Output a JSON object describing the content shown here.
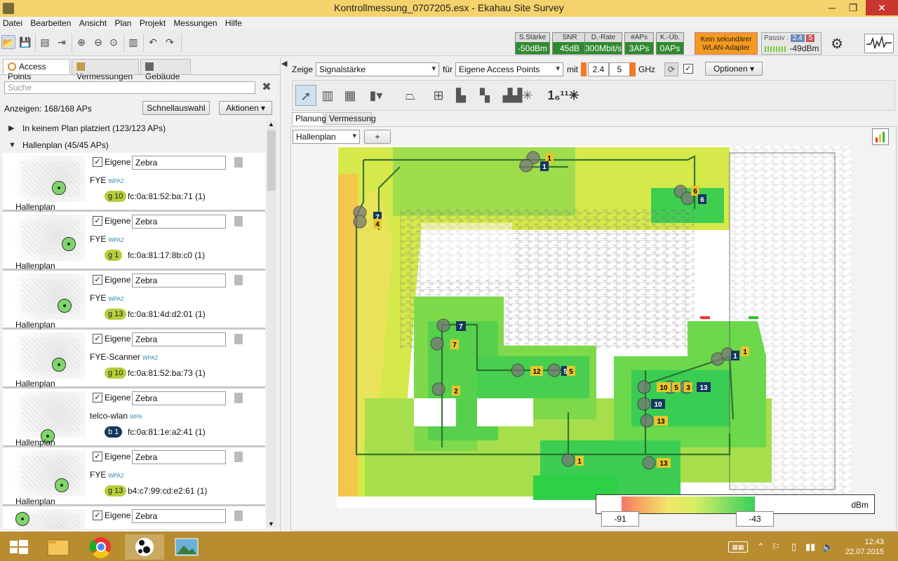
{
  "window": {
    "title": "Kontrollmessung_0707205.esx - Ekahau Site Survey",
    "minimize": "─",
    "maximize": "❐",
    "close": "✕"
  },
  "menu": [
    "Datei",
    "Bearbeiten",
    "Ansicht",
    "Plan",
    "Projekt",
    "Messungen",
    "Hilfe"
  ],
  "stats": [
    {
      "label": "S.Stärke",
      "value": "-50dBm"
    },
    {
      "label": "SNR",
      "value": "45dB"
    },
    {
      "label": "D.-Rate",
      "value": "300Mbit/s"
    },
    {
      "label": "#APs",
      "value": "3APs"
    },
    {
      "label": "K.-Üb.",
      "value": "0APs"
    }
  ],
  "warning": {
    "line1": "Kein sekundärer",
    "line2": "WLAN-Adapter"
  },
  "passive": {
    "label": "Passiv :",
    "band24": "2.4",
    "band5": "5",
    "value": "-49dBm"
  },
  "left": {
    "tabs": [
      "Access Points",
      "Vermessungen",
      "Gebäude"
    ],
    "search_placeholder": "Suche",
    "count": "Anzeigen: 168/168 APs",
    "quick_select": "Schnellauswahl",
    "actions": "Aktionen ▾",
    "groups": [
      "In keinem Plan platziert (123/123 APs)",
      "Hallenplan (45/45 APs)"
    ],
    "aps": [
      {
        "own": "Eigene",
        "vendor": "Zebra",
        "ssid": "FYE",
        "enc": "WPA2",
        "chan": "g 10",
        "chantype": "g",
        "mac": "fc:0a:81:52:ba:71 (1)",
        "floor": "Hallenplan"
      },
      {
        "own": "Eigene",
        "vendor": "Zebra",
        "ssid": "FYE",
        "enc": "WPA2",
        "chan": "g 1",
        "chantype": "g",
        "mac": "fc:0a:81:17:8b:c0 (1)",
        "floor": "Hallenplan"
      },
      {
        "own": "Eigene",
        "vendor": "Zebra",
        "ssid": "FYE",
        "enc": "WPA2",
        "chan": "g 13",
        "chantype": "g",
        "mac": "fc:0a:81:4d:d2:01 (1)",
        "floor": "Hallenplan"
      },
      {
        "own": "Eigene",
        "vendor": "Zebra",
        "ssid": "FYE-Scanner",
        "enc": "WPA2",
        "chan": "g 10",
        "chantype": "g",
        "mac": "fc:0a:81:52:ba:73 (1)",
        "floor": "Hallenplan"
      },
      {
        "own": "Eigene",
        "vendor": "Zebra",
        "ssid": "telco-wlan",
        "enc": "WPA",
        "chan": "b 1",
        "chantype": "b",
        "mac": "fc:0a:81:1e:a2:41 (1)",
        "floor": "Hallenplan"
      },
      {
        "own": "Eigene",
        "vendor": "Zebra",
        "ssid": "FYE",
        "enc": "WPA2",
        "chan": "g 13",
        "chantype": "g",
        "mac": "b4:c7:99:cd:e2:61 (1)",
        "floor": "Hallenplan"
      },
      {
        "own": "Eigene",
        "vendor": "Zebra",
        "ssid": "",
        "enc": "",
        "chan": "",
        "chantype": "g",
        "mac": "",
        "floor": ""
      }
    ]
  },
  "right": {
    "show_label": "Zeige",
    "show_value": "Signalstärke",
    "for_label": "für",
    "for_value": "Eigene Access Points",
    "with_label": "mit",
    "band1": "2.4",
    "band2": "5",
    "ghz": "GHz",
    "options": "Optionen ▾",
    "subtabs": [
      "Planung",
      "Vermessung"
    ],
    "floor_select": "Hallenplan",
    "add": "+",
    "legend_unit": "dBm",
    "legend_min": "-91",
    "legend_max": "-43"
  },
  "map_labels": [
    "1",
    "1",
    "6",
    "6",
    "7",
    "4",
    "7",
    "7",
    "2",
    "12",
    "5",
    "5",
    "1",
    "1",
    "10",
    "5",
    "3",
    "13",
    "10",
    "13",
    "1",
    "13"
  ],
  "taskbar": {
    "time": "12:43",
    "date": "22.07.2015"
  }
}
